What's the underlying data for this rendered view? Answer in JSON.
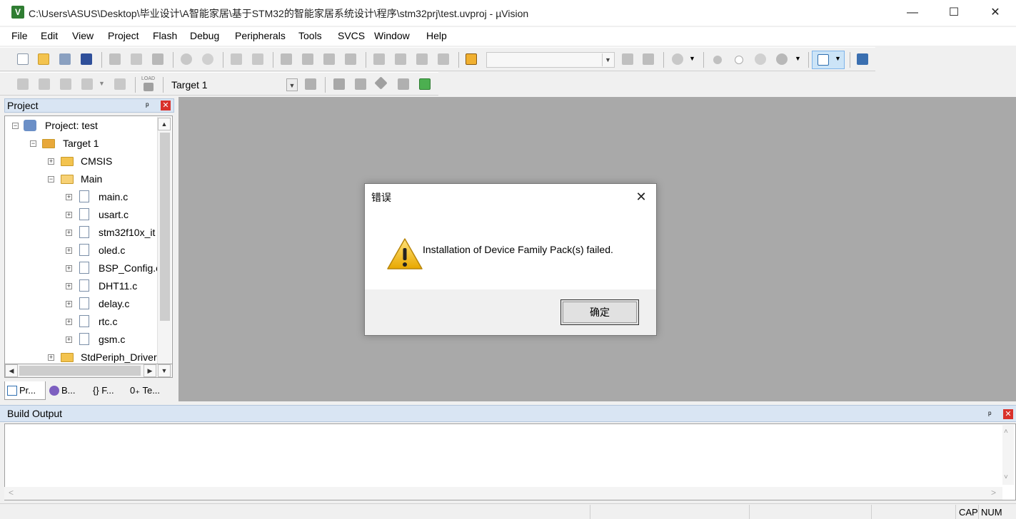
{
  "window": {
    "title": "C:\\Users\\ASUS\\Desktop\\毕业设计\\A智能家居\\基于STM32的智能家居系统设计\\程序\\stm32prj\\test.uvproj - µVision",
    "minimize": "—",
    "maximize": "☐",
    "close": "✕",
    "app_icon_text": "V"
  },
  "menu": [
    "File",
    "Edit",
    "View",
    "Project",
    "Flash",
    "Debug",
    "Peripherals",
    "Tools",
    "SVCS",
    "Window",
    "Help"
  ],
  "toolbar": {
    "target_select": "Target 1",
    "find_combo": "",
    "load_label": "LOAD"
  },
  "project_panel": {
    "title": "Project",
    "pin": "ᵖ",
    "close": "✕",
    "tree": [
      {
        "label": "Project: test",
        "level": 0,
        "type": "project",
        "expander": "−"
      },
      {
        "label": "Target 1",
        "level": 1,
        "type": "target",
        "expander": "−"
      },
      {
        "label": "CMSIS",
        "level": 2,
        "type": "folder",
        "expander": "+"
      },
      {
        "label": "Main",
        "level": 2,
        "type": "folder-open",
        "expander": "−"
      },
      {
        "label": "main.c",
        "level": 3,
        "type": "file",
        "expander": "+"
      },
      {
        "label": "usart.c",
        "level": 3,
        "type": "file",
        "expander": "+"
      },
      {
        "label": "stm32f10x_it",
        "level": 3,
        "type": "file",
        "expander": "+"
      },
      {
        "label": "oled.c",
        "level": 3,
        "type": "file",
        "expander": "+"
      },
      {
        "label": "BSP_Config.c",
        "level": 3,
        "type": "file",
        "expander": "+"
      },
      {
        "label": "DHT11.c",
        "level": 3,
        "type": "file",
        "expander": "+"
      },
      {
        "label": "delay.c",
        "level": 3,
        "type": "file",
        "expander": "+"
      },
      {
        "label": "rtc.c",
        "level": 3,
        "type": "file",
        "expander": "+"
      },
      {
        "label": "gsm.c",
        "level": 3,
        "type": "file",
        "expander": "+"
      },
      {
        "label": "StdPeriph_Driver",
        "level": 2,
        "type": "folder",
        "expander": "+"
      }
    ],
    "tabs": [
      "Pr...",
      "B...",
      "{} F...",
      "0₊ Te..."
    ]
  },
  "build_output": {
    "title": "Build Output",
    "pin": "ᵖ",
    "close": "✕",
    "content": ""
  },
  "status_bar": {
    "cap": "CAP",
    "num": "NUM"
  },
  "dialog": {
    "title": "错误",
    "message": "Installation of Device Family Pack(s) failed.",
    "ok_label": "确定",
    "close": "✕",
    "icon": "warning-icon"
  },
  "colors": {
    "editor_background": "#a9a9a9",
    "panel_header": "#d9e5f3",
    "close_red": "#d9312b",
    "folder_yellow": "#f3c34e"
  }
}
